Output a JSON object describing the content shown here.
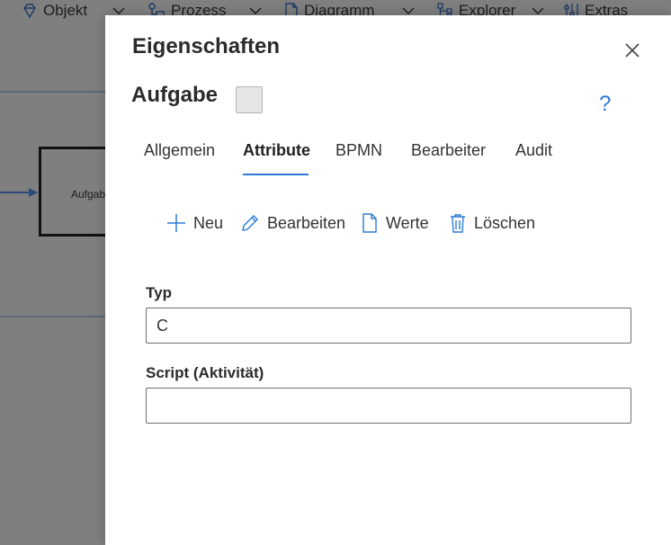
{
  "background_toolbar": {
    "items": [
      {
        "label": "Objekt",
        "icon": "diamond-icon"
      },
      {
        "label": "Prozess",
        "icon": "process-icon"
      },
      {
        "label": "Diagramm",
        "icon": "document-icon"
      },
      {
        "label": "Explorer",
        "icon": "tree-icon"
      },
      {
        "label": "Extras",
        "icon": "settings-sliders-icon"
      }
    ]
  },
  "background_canvas": {
    "task_label": "Aufgabe"
  },
  "modal": {
    "title": "Eigenschaften",
    "entity_title": "Aufgabe",
    "help_symbol": "?",
    "tabs": [
      {
        "label": "Allgemein",
        "active": false
      },
      {
        "label": "Attribute",
        "active": true
      },
      {
        "label": "BPMN",
        "active": false
      },
      {
        "label": "Bearbeiter",
        "active": false
      },
      {
        "label": "Audit",
        "active": false
      }
    ],
    "actions": [
      {
        "label": "Neu",
        "icon": "plus-icon"
      },
      {
        "label": "Bearbeiten",
        "icon": "pencil-icon"
      },
      {
        "label": "Werte",
        "icon": "document-icon"
      },
      {
        "label": "Löschen",
        "icon": "trash-icon"
      }
    ],
    "fields": [
      {
        "label": "Typ",
        "value": "C",
        "placeholder": ""
      },
      {
        "label": "Script (Aktivität)",
        "value": "",
        "placeholder": ""
      }
    ]
  },
  "colors": {
    "accent": "#2b7bd6",
    "overlay": "#7f7f7f",
    "swatch": "#e6e6e6"
  }
}
